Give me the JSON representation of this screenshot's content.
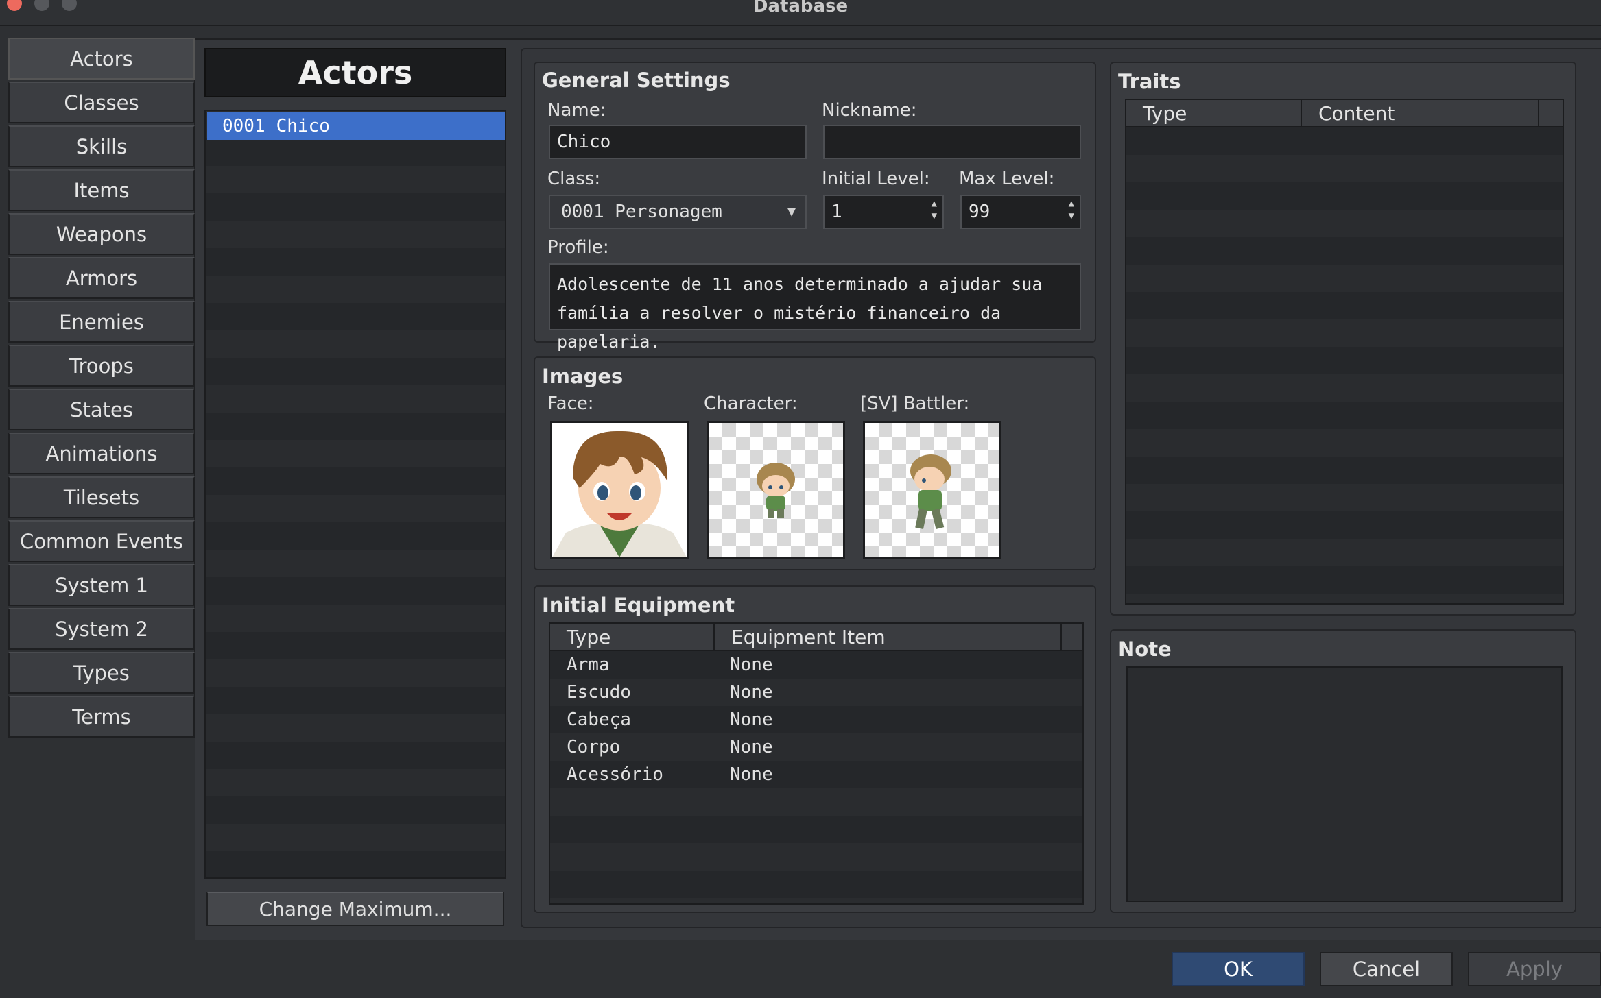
{
  "window": {
    "title": "Database"
  },
  "categories": [
    "Actors",
    "Classes",
    "Skills",
    "Items",
    "Weapons",
    "Armors",
    "Enemies",
    "Troops",
    "States",
    "Animations",
    "Tilesets",
    "Common Events",
    "System 1",
    "System 2",
    "Types",
    "Terms"
  ],
  "actor_list": {
    "header": "Actors",
    "items": [
      {
        "id": "0001",
        "name": "Chico",
        "selected": true
      }
    ],
    "change_max_label": "Change Maximum..."
  },
  "general": {
    "title": "General Settings",
    "name_label": "Name:",
    "name_value": "Chico",
    "nickname_label": "Nickname:",
    "nickname_value": "",
    "class_label": "Class:",
    "class_value": "0001 Personagem",
    "initial_level_label": "Initial Level:",
    "initial_level_value": "1",
    "max_level_label": "Max Level:",
    "max_level_value": "99",
    "profile_label": "Profile:",
    "profile_line1": "Adolescente de 11 anos determinado a ajudar sua",
    "profile_line2": "família a resolver o mistério financeiro da papelaria."
  },
  "images": {
    "title": "Images",
    "face_label": "Face:",
    "character_label": "Character:",
    "battler_label": "[SV] Battler:"
  },
  "equipment": {
    "title": "Initial Equipment",
    "col_type": "Type",
    "col_item": "Equipment Item",
    "rows": [
      {
        "type": "Arma",
        "item": "None"
      },
      {
        "type": "Escudo",
        "item": "None"
      },
      {
        "type": "Cabeça",
        "item": "None"
      },
      {
        "type": "Corpo",
        "item": "None"
      },
      {
        "type": "Acessório",
        "item": "None"
      }
    ]
  },
  "traits": {
    "title": "Traits",
    "col_type": "Type",
    "col_content": "Content"
  },
  "note": {
    "title": "Note",
    "value": ""
  },
  "buttons": {
    "ok": "OK",
    "cancel": "Cancel",
    "apply": "Apply"
  },
  "colors": {
    "selection": "#3d6fc9",
    "close": "#ed6a5e",
    "ok_button": "#2f4a73"
  }
}
